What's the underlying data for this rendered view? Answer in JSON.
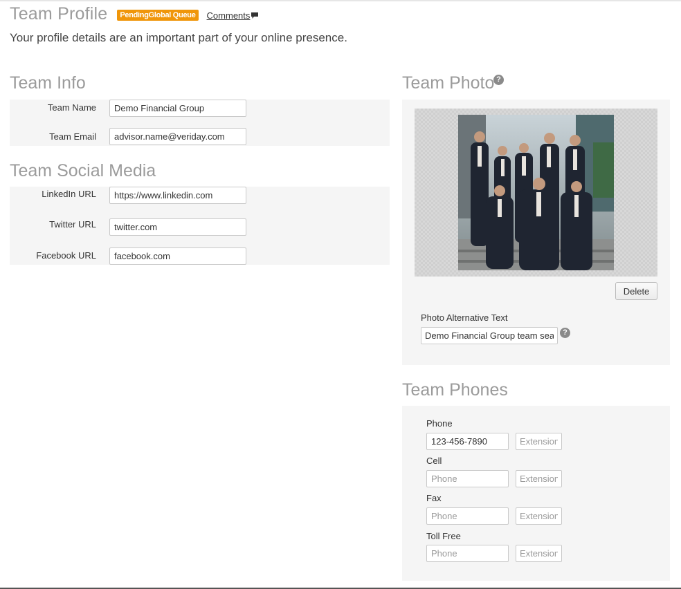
{
  "header": {
    "title": "Team Profile",
    "badge": "PendingGlobal Queue",
    "comments_label": "Comments",
    "subtitle": "Your profile details are an important part of your online presence."
  },
  "team_info": {
    "title": "Team Info",
    "team_name_label": "Team Name",
    "team_name_value": "Demo Financial Group",
    "team_email_label": "Team Email",
    "team_email_value": "advisor.name@veriday.com"
  },
  "social": {
    "title": "Team Social Media",
    "linkedin_label": "LinkedIn URL",
    "linkedin_value": "https://www.linkedin.com",
    "twitter_label": "Twitter URL",
    "twitter_value": "twitter.com",
    "facebook_label": "Facebook URL",
    "facebook_value": "facebook.com"
  },
  "photo": {
    "title": "Team Photo",
    "help_icon": "question-circle-icon",
    "delete_label": "Delete",
    "alt_label": "Photo Alternative Text",
    "alt_value": "Demo Financial Group team seate"
  },
  "phones": {
    "title": "Team Phones",
    "phone_label": "Phone",
    "phone_value": "123-456-7890",
    "cell_label": "Cell",
    "fax_label": "Fax",
    "tollfree_label": "Toll Free",
    "phone_placeholder": "Phone",
    "extension_placeholder": "Extension"
  },
  "colors": {
    "badge": "#f0960a",
    "panel": "#f5f5f5",
    "heading": "#9b9b9b"
  }
}
